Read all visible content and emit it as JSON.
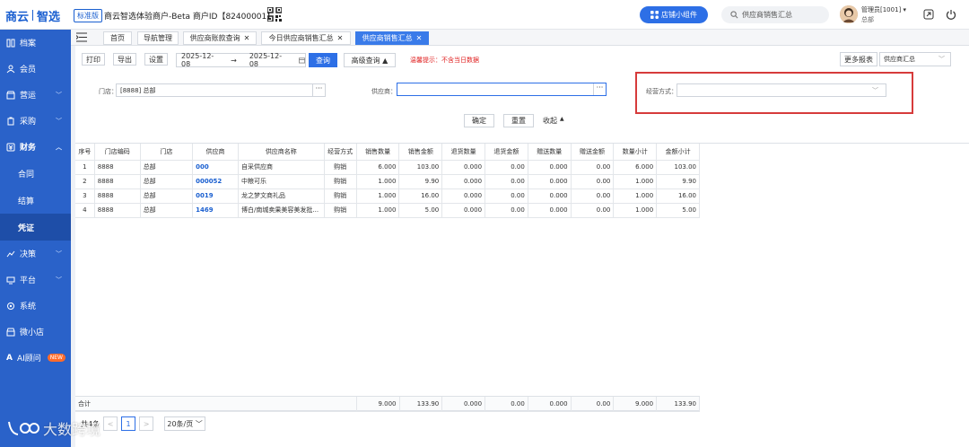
{
  "brand": {
    "logo_part1": "商云",
    "logo_part2": "智选",
    "edition": "标准版",
    "merchant": "商云智选体验商户-Beta  商户ID【82400001】"
  },
  "header": {
    "widget_button": "店铺小组件",
    "search_placeholder": "供应商销售汇总",
    "user_name": "管理员[1001]",
    "user_store": "总部"
  },
  "sidebar": {
    "items": [
      {
        "label": "档案"
      },
      {
        "label": "会员"
      },
      {
        "label": "营运"
      },
      {
        "label": "采购"
      },
      {
        "label": "财务"
      },
      {
        "label": "合同"
      },
      {
        "label": "结算"
      },
      {
        "label": "凭证"
      },
      {
        "label": "决策"
      },
      {
        "label": "平台"
      },
      {
        "label": "系统"
      },
      {
        "label": "微小店"
      },
      {
        "label": "AI顾问"
      }
    ],
    "new_badge": "NEW"
  },
  "tabs": [
    {
      "label": "首页"
    },
    {
      "label": "导航管理"
    },
    {
      "label": "供应商账款查询"
    },
    {
      "label": "今日供应商销售汇总"
    },
    {
      "label": "供应商销售汇总"
    }
  ],
  "toolbar": {
    "print": "打印",
    "export": "导出",
    "settings": "设置",
    "date_from": "2025-12-08",
    "date_sep": "→",
    "date_to": "2025-12-08",
    "query": "查询",
    "advanced": "高级查询",
    "warning": "温馨提示：不含当日数据",
    "more_reports": "更多报表",
    "report_type": "供应商汇总"
  },
  "filters": {
    "store_label": "门店：",
    "store_value": "[8888]  总部",
    "supplier_label": "供应商：",
    "supplier_value": "",
    "mode_label": "经营方式：",
    "mode_value": "",
    "confirm": "确定",
    "reset": "重置",
    "collapse": "收起"
  },
  "table": {
    "columns": [
      "序号",
      "门店编码",
      "门店",
      "供应商",
      "供应商名称",
      "经营方式",
      "销售数量",
      "销售金额",
      "退货数量",
      "退货金额",
      "赠送数量",
      "赠送金额",
      "数量小计",
      "金额小计"
    ],
    "rows": [
      [
        "1",
        "8888",
        "总部",
        "000",
        "自采供应商",
        "购销",
        "6.000",
        "103.00",
        "0.000",
        "0.00",
        "0.000",
        "0.00",
        "6.000",
        "103.00"
      ],
      [
        "2",
        "8888",
        "总部",
        "000052",
        "中粮可乐",
        "购销",
        "1.000",
        "9.90",
        "0.000",
        "0.00",
        "0.000",
        "0.00",
        "1.000",
        "9.90"
      ],
      [
        "3",
        "8888",
        "总部",
        "0019",
        "龙之梦文商礼品",
        "购销",
        "1.000",
        "16.00",
        "0.000",
        "0.00",
        "0.000",
        "0.00",
        "1.000",
        "16.00"
      ],
      [
        "4",
        "8888",
        "总部",
        "1469",
        "博白/南城卖果美容美发批...",
        "购销",
        "1.000",
        "5.00",
        "0.000",
        "0.00",
        "0.000",
        "0.00",
        "1.000",
        "5.00"
      ]
    ],
    "totals_label": "合计",
    "totals": [
      "9.000",
      "133.90",
      "0.000",
      "0.00",
      "0.000",
      "0.00",
      "9.000",
      "133.90"
    ]
  },
  "pager": {
    "total": "共4条",
    "prev": "<",
    "current": "1",
    "next": ">",
    "page_size": "20条/页"
  },
  "watermark": "大数跨境"
}
